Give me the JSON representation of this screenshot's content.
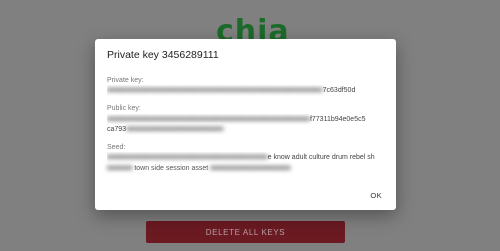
{
  "backdrop": {
    "logo_text": "chia",
    "delete_all_keys_label": "DELETE ALL KEYS"
  },
  "dialog": {
    "title": "Private key 3456289111",
    "private_key": {
      "label": "Private key:",
      "value_tail": "7c63df50d"
    },
    "public_key": {
      "label": "Public key:",
      "value_line1_tail": "f77311b94e0e5c5",
      "value_line2_head": "ca793"
    },
    "seed": {
      "label": "Seed:",
      "value_line1_tail": "e know adult culture drum rebel sh",
      "value_line2": "town side session asset"
    },
    "ok_label": "OK"
  },
  "colors": {
    "backdrop": "#808080",
    "dialog_bg": "#ffffff",
    "delete_button": "#6b1a22",
    "logo_green": "#1c6b2a"
  }
}
